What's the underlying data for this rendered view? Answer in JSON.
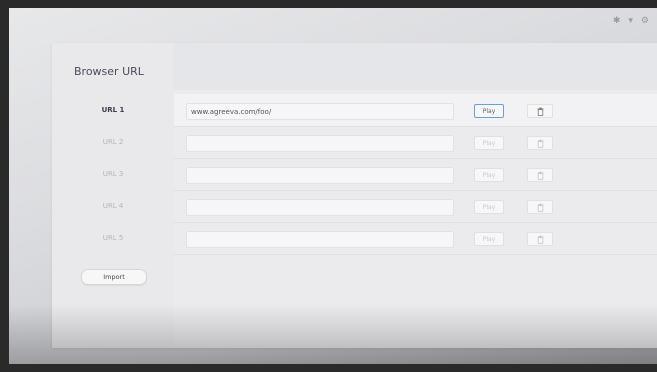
{
  "sidebar": {
    "title": "Browser URL",
    "items": [
      {
        "label": "URL 1",
        "active": true
      },
      {
        "label": "URL 2",
        "active": false
      },
      {
        "label": "URL 3",
        "active": false
      },
      {
        "label": "URL 4",
        "active": false
      },
      {
        "label": "URL 5",
        "active": false
      }
    ],
    "import_label": "Import"
  },
  "rows": [
    {
      "url": "www.agreeva.com/foo/",
      "play_label": "Play"
    },
    {
      "url": "",
      "play_label": "Play"
    },
    {
      "url": "",
      "play_label": "Play"
    },
    {
      "url": "",
      "play_label": "Play"
    },
    {
      "url": "",
      "play_label": "Play"
    }
  ],
  "icons": {
    "delete": "trash-icon",
    "status": [
      "bluetooth-icon",
      "wifi-icon",
      "settings-icon"
    ]
  },
  "colors": {
    "focus_border": "#6aa0d8",
    "panel_bg": "#eeeff1"
  }
}
